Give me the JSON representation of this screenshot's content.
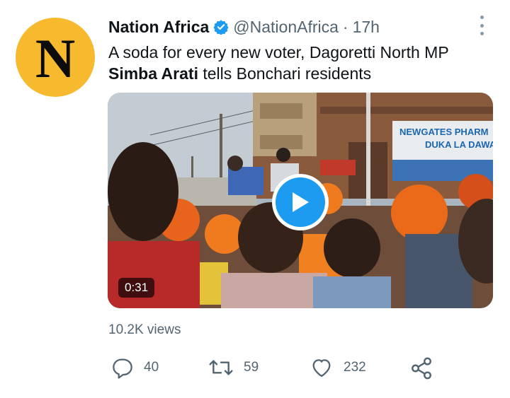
{
  "tweet": {
    "author_name": "Nation Africa",
    "handle": "@NationAfrica",
    "separator": "·",
    "time": "17h",
    "avatar_letter": "N",
    "text_part1": "A soda for every new voter, Dagoretti North MP ",
    "text_bold": "Simba Arati",
    "text_part2": " tells Bonchari residents",
    "video_duration": "0:31",
    "views": "10.2K views"
  },
  "actions": {
    "reply_count": "40",
    "retweet_count": "59",
    "like_count": "232"
  },
  "video_signs": {
    "sign_line1": "NEWGATES PHARM",
    "sign_line2": "DUKA LA DAWA"
  },
  "colors": {
    "avatar_bg": "#f7b92e",
    "verified_blue": "#1d9bf0",
    "muted_text": "#536471"
  },
  "icons": [
    "avatar-n-logo",
    "verified-badge-icon",
    "more-options-icon",
    "play-icon",
    "reply-icon",
    "retweet-icon",
    "like-icon",
    "share-icon"
  ]
}
